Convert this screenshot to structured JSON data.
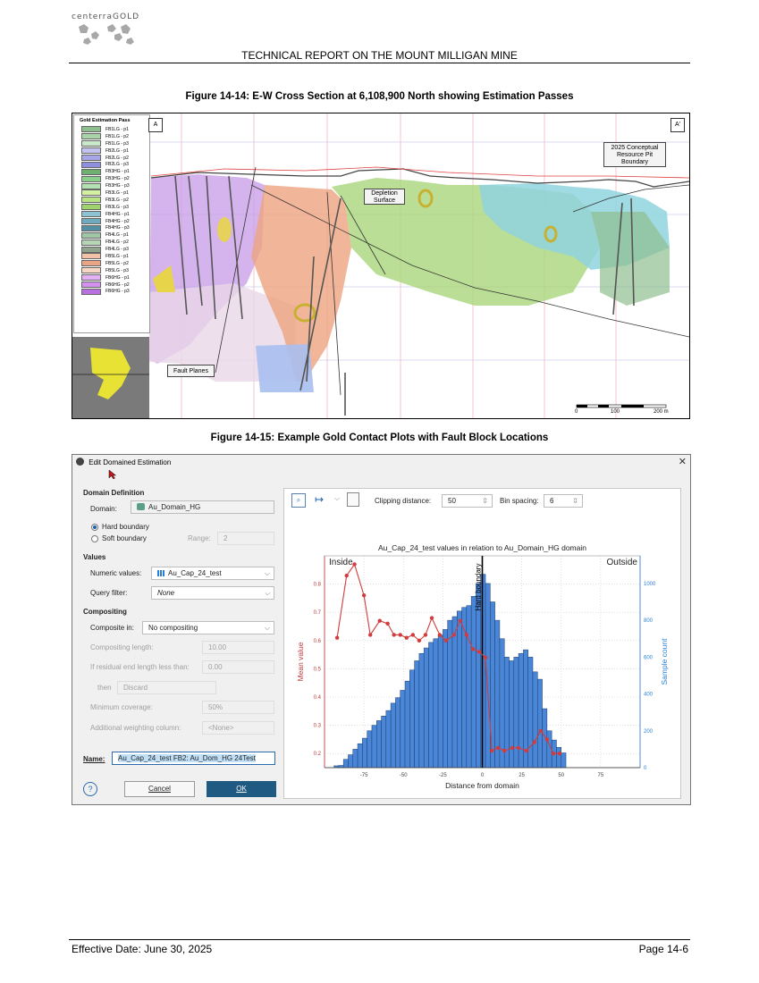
{
  "header": {
    "logo_text": "centerraGOLD",
    "report_title": "TECHNICAL REPORT ON THE MOUNT MILLIGAN MINE"
  },
  "figure1": {
    "caption": "Figure 14-14: E-W Cross Section at 6,108,900 North showing Estimation Passes",
    "legend_title": "Gold Estimation Pass",
    "legend_items": [
      {
        "label": "FB1LG - p1",
        "color": "#8fbf8f"
      },
      {
        "label": "FB1LG - p2",
        "color": "#a9d4a9"
      },
      {
        "label": "FB1LG - p3",
        "color": "#c9e8c9"
      },
      {
        "label": "FB2LG - p1",
        "color": "#c3c3ef"
      },
      {
        "label": "FB2LG - p2",
        "color": "#a7a7e8"
      },
      {
        "label": "FB2LG - p3",
        "color": "#8f8fdf"
      },
      {
        "label": "FB3HG - p1",
        "color": "#6faf6f"
      },
      {
        "label": "FB3HG - p2",
        "color": "#8ccf8c"
      },
      {
        "label": "FB3HG - p3",
        "color": "#b3e0b3"
      },
      {
        "label": "FB3LG - p1",
        "color": "#d2f0a0"
      },
      {
        "label": "FB3LG - p2",
        "color": "#b9e486"
      },
      {
        "label": "FB3LG - p3",
        "color": "#9fd46c"
      },
      {
        "label": "FB4HG - p1",
        "color": "#8fc3d3"
      },
      {
        "label": "FB4HG - p2",
        "color": "#6fa9bd"
      },
      {
        "label": "FB4HG - p3",
        "color": "#558fa3"
      },
      {
        "label": "FB4LG - p1",
        "color": "#9fc7a7"
      },
      {
        "label": "FB4LG - p2",
        "color": "#b5d3b5"
      },
      {
        "label": "FB4LG - p3",
        "color": "#8fa38f"
      },
      {
        "label": "FB5LG - p1",
        "color": "#f3c1a7"
      },
      {
        "label": "FB5LG - p2",
        "color": "#e9a385"
      },
      {
        "label": "FB5LG - p3",
        "color": "#f7d7c3"
      },
      {
        "label": "FB6HG - p1",
        "color": "#e3b1f3"
      },
      {
        "label": "FB6HG - p2",
        "color": "#d391ef"
      },
      {
        "label": "FB6HG - p3",
        "color": "#b86fe0"
      }
    ],
    "corner_a": "A",
    "corner_a2": "A'",
    "callout_depletion": "Depletion Surface",
    "callout_pit": "2025 Conceptual Resource Pit Boundary",
    "callout_fault": "Fault Planes",
    "scale": {
      "zero": "0",
      "mid": "100",
      "end": "200 m"
    }
  },
  "figure2": {
    "caption": "Figure 14-15: Example Gold Contact Plots with Fault Block Locations",
    "dialog_title": "Edit Domained Estimation",
    "domain_definition": "Domain Definition",
    "domain_label": "Domain:",
    "domain_value": "Au_Domain_HG",
    "hard_boundary": "Hard boundary",
    "soft_boundary": "Soft boundary",
    "range_label": "Range:",
    "range_value": "2",
    "values_heading": "Values",
    "numeric_values_label": "Numeric values:",
    "numeric_values_value": "Au_Cap_24_test",
    "query_filter_label": "Query filter:",
    "query_filter_value": "None",
    "compositing_heading": "Compositing",
    "composite_in_label": "Composite in:",
    "composite_in_value": "No compositing",
    "compositing_length_label": "Compositing length:",
    "compositing_length_value": "10.00",
    "residual_label": "If residual end length less than:",
    "residual_value": "0.00",
    "then_label": "then",
    "then_value": "Discard",
    "min_coverage_label": "Minimum coverage:",
    "min_coverage_value": "50%",
    "weighting_label": "Additional weighting column:",
    "weighting_value": "<None>",
    "name_label": "Name:",
    "name_value": "Au_Cap_24_test FB2: Au_Dom_HG 24Test",
    "cancel": "Cancel",
    "ok": "OK",
    "help": "?",
    "clipping_label": "Clipping distance:",
    "clipping_value": "50",
    "bin_label": "Bin spacing:",
    "bin_value": "6"
  },
  "chart_data": {
    "type": "bar",
    "title": "Au_Cap_24_test values in relation to Au_Domain_HG domain",
    "xlabel": "Distance from domain",
    "ylabel_left": "Mean value",
    "ylabel_right": "Sample count",
    "annotation_inside": "Inside",
    "annotation_outside": "Outside",
    "annotation_boundary": "Hard boundary",
    "xlim": [
      -100,
      100
    ],
    "ylim_left": [
      0.15,
      0.9
    ],
    "ylim_right": [
      0,
      1150
    ],
    "xticks": [
      -75,
      -50,
      -25,
      0,
      25,
      50,
      75
    ],
    "yticks_left": [
      0.2,
      0.3,
      0.4,
      0.5,
      0.6,
      0.7,
      0.8
    ],
    "yticks_right": [
      0,
      200,
      400,
      600,
      800,
      1000
    ],
    "bar_width": 3,
    "bars": {
      "x": [
        -92.5,
        -89.5,
        -86.5,
        -83.5,
        -80.5,
        -77.5,
        -74.5,
        -71.5,
        -68.5,
        -65.5,
        -62.5,
        -59.5,
        -56.5,
        -53.5,
        -50.5,
        -47.5,
        -44.5,
        -41.5,
        -38.5,
        -35.5,
        -32.5,
        -29.5,
        -26.5,
        -23.5,
        -20.5,
        -17.5,
        -14.5,
        -11.5,
        -8.5,
        -5.5,
        -2.5,
        0.5,
        3.5,
        6.5,
        9.5,
        12.5,
        15.5,
        18.5,
        21.5,
        24.5,
        27.5,
        30.5,
        33.5,
        36.5,
        39.5,
        42.5,
        45.5,
        48.5,
        51.5
      ],
      "counts": [
        10,
        12,
        45,
        70,
        100,
        130,
        160,
        200,
        230,
        255,
        280,
        310,
        350,
        380,
        420,
        470,
        530,
        580,
        620,
        650,
        680,
        700,
        720,
        750,
        800,
        820,
        850,
        870,
        880,
        930,
        1000,
        1050,
        1000,
        900,
        800,
        700,
        600,
        580,
        600,
        620,
        640,
        600,
        520,
        480,
        320,
        200,
        150,
        110,
        80
      ]
    },
    "series": [
      {
        "name": "Mean value",
        "x": [
          -92,
          -86,
          -81,
          -75,
          -71,
          -65,
          -60,
          -56,
          -52,
          -48,
          -44,
          -40,
          -36,
          -32,
          -27,
          -23,
          -18,
          -14,
          -10,
          -6,
          -2,
          2,
          6,
          10,
          14,
          19,
          23,
          28,
          33,
          37,
          41,
          45,
          49
        ],
        "values": [
          0.61,
          0.83,
          0.87,
          0.76,
          0.62,
          0.67,
          0.66,
          0.62,
          0.62,
          0.61,
          0.62,
          0.6,
          0.62,
          0.68,
          0.62,
          0.6,
          0.62,
          0.67,
          0.62,
          0.57,
          0.56,
          0.54,
          0.21,
          0.22,
          0.21,
          0.22,
          0.22,
          0.21,
          0.24,
          0.28,
          0.25,
          0.2,
          0.2
        ]
      }
    ],
    "grid": true
  },
  "footer": {
    "effective_date": "Effective Date: June 30, 2025",
    "page": "Page 14-6"
  }
}
